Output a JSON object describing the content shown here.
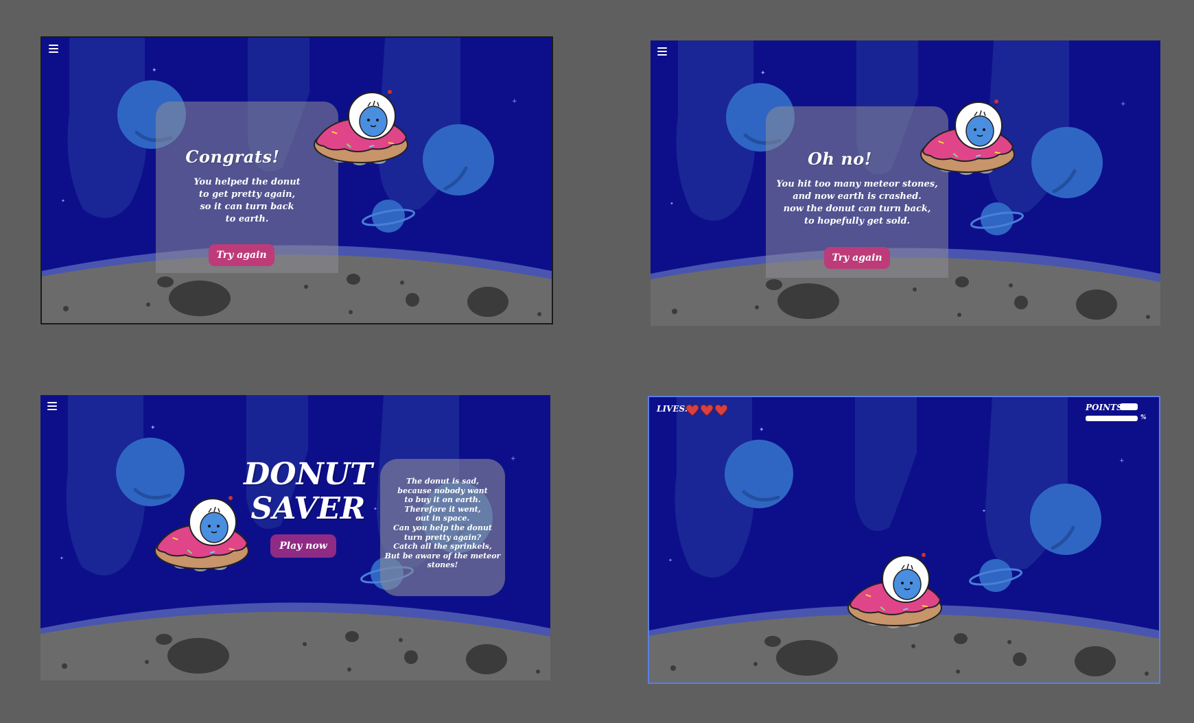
{
  "screens": {
    "congrats": {
      "title": "Congrats!",
      "message": "You helped the donut\nto get pretty again,\nso it can turn back\nto earth.",
      "button": "Try again"
    },
    "gameover": {
      "title": "Oh no!",
      "message": "You hit too many meteor stones,\nand now earth is crashed.\nnow the donut can turn back,\nto hopefully get sold.",
      "button": "Try again"
    },
    "start": {
      "title": "DONUT\nSAVER",
      "button": "Play now",
      "story": "The donut is sad,\nbecause nobody want\nto buy it on earth.\nTherefore it went,\nout in space.\nCan you help the donut\nturn pretty again?\nCatch all the sprinkels,\nBut be aware of the meteor\nstones!"
    },
    "game": {
      "lives_label": "LIVES:",
      "lives": 3,
      "points_label": "POINTS:",
      "progress_suffix": "%"
    }
  },
  "colors": {
    "background": "#5f5f5f",
    "space": "#0d0f8a",
    "planet": "#2f66c4",
    "moon": "#6b6b6b",
    "button": "#bd3b79",
    "heart": "#d94040"
  },
  "icons": [
    "menu-icon",
    "heart-icon",
    "astronaut-donut-ufo",
    "planet-icon",
    "star-icon"
  ]
}
